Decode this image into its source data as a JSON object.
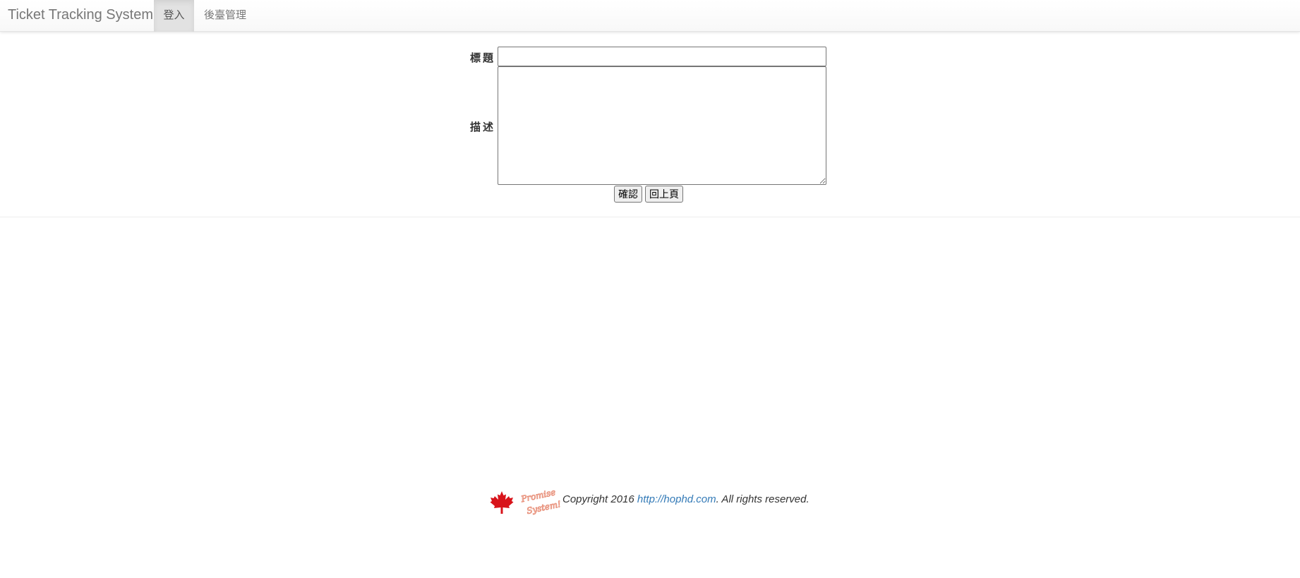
{
  "navbar": {
    "brand": "Ticket Tracking System",
    "items": [
      {
        "label": "登入",
        "active": true
      },
      {
        "label": "後臺管理",
        "active": false
      }
    ]
  },
  "form": {
    "title_label": "標題",
    "title_value": "",
    "description_label": "描述",
    "description_value": "",
    "confirm_button": "確認",
    "back_button": "回上頁"
  },
  "footer": {
    "logo_text_line1": "Promise",
    "logo_text_line2": "System!",
    "copyright_prefix": "Copyright 2016 ",
    "link_text": "http://hophd.com",
    "copyright_suffix": ". All rights reserved.",
    "colors": {
      "leaf": "#d8141b",
      "logo_text": "#e8907a",
      "link": "#337ab7"
    }
  }
}
